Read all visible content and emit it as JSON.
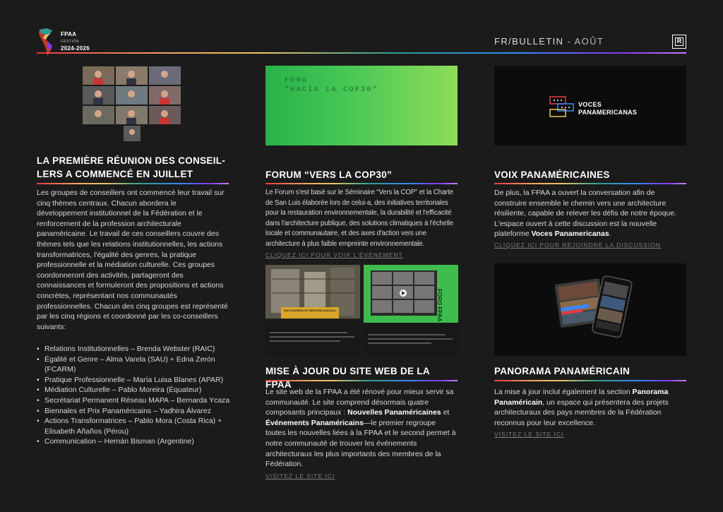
{
  "header": {
    "logo_title": "FPAA",
    "logo_sub": "GESTIÓN",
    "logo_years": "2024-2026",
    "bulletin": "FR/BULLETIN",
    "month": " - AOÛT",
    "r_icon_letter": "R"
  },
  "col1": {
    "title_line1": "LA PREMIÈRE RÉUNION DES CONSEIL-",
    "title_line2": "LERS A COMMENCÉ EN JUILLET",
    "paragraph": "Les groupes de conseillers ont commencé leur travail sur cinq thèmes centraux. Chacun abordera le développement institutionnel de la Fédération et le renforcement de la profession architecturale panaméricaine. Le travail de ces conseillers couvre des thèmes tels que les relations institutionnelles, les actions transformatrices, l'égalité des genres, la pratique professionnelle et la médiation culturelle. Ces groupes coordonneront des activités, partageront des connaissances et formuleront des propositions et actions concrètes, représentant nos communautés professionnelles. Chacun des cinq groupes est représenté par les cinq régions et coordonné par les co-conseillers suivants:",
    "list": [
      "Relations Institutionnelles – Brenda Webster (RAIC)",
      "Égalité et Genre – Alma Varela (SAU) + Edna Zerón (FCARM)",
      "Pratique Professionnelle – María Luisa Blanes (APAR)",
      "Médiation Culturelle – Pablo Moreira (Équateur)",
      "Secrétariat Permanent Réseau MAPA – Bernarda Ycaza",
      "Biennales et Prix Panaméricains – Yadhira Álvarez",
      "Actions Transformatrices – Pablo Mora (Costa Rica) + Elisabeth Añaños (Pérou)",
      "Communication – Hernán Bisman (Argentine)"
    ]
  },
  "col2": {
    "banner_line1": "FORO",
    "banner_line2": "\"HACIA LA COP30\"",
    "title": "FORUM “VERS LA COP30”",
    "paragraph": "Le Forum s'est basé sur le Séminaire “Vers la COP” et la Charte de San Luis élaborée lors de celui-a, des initiatives territoriales pour la restauration environnementale, la durabilité et l'efficacité dans l'architecture publique, des solutions climatiques à l'échelle locale et communautaire, et des axes d'action vers une architecture à plus faible empreinte environnementale.",
    "link": "CLIQUEZ ICI POUR VOIR L'ÉVÉNEMENT",
    "title2": "MISE À JOUR DU SITE WEB DE LA FPAA",
    "p2_a": "Le site web de la FPAA a été rénové pour mieux servir sa communauté. Le site comprend désormais quatre composants principaux : ",
    "p2_b1": "Nouvelles Panaméricaines",
    "p2_c": " et ",
    "p2_b2": "Événements Panaméricains",
    "p2_d": "—le premier regroupe toutes les nouvelles liées à la FPAA et le second permet à notre communauté de trouver les événements architecturaux les plus importants des membres de la Fédération.",
    "link2": "VISITEZ LE SITE ICI",
    "shot1_caption": "SAU CONVERSA DE OBRA REALIZADA (EL)",
    "shot2_caption": "FORO FPAA"
  },
  "col3": {
    "voces_line1": "VOCES",
    "voces_line2": "PANAMERICANAS",
    "title": "VOIX PANAMÉRICAINES",
    "p_a": "De plus, la FPAA a ouvert la conversation afin de construire ensemble le chemin vers une architecture résiliente, capable de relever les défis de notre époque. L'espace ouvert à cette discussion est la nouvelle plateforme ",
    "p_b": "Voces Panamericanas",
    "p_c": ".",
    "link": "CLIQUEZ ICI POUR REJOINDRE LA DISCUSSION",
    "title2": "PANORAMA PANAMÉRICAIN",
    "p2_a": "La mise à jour inclut également la section ",
    "p2_b": "Panorama Panaméricain",
    "p2_c": ", un espace qui présentera des projets architecturaux des pays membres de la Fédération reconnus pour leur excellence.",
    "link2": "VISITEZ LE SITE ICI"
  },
  "colors": {
    "background": "#1b1b1b",
    "cop_green": "#3cc85a",
    "text": "#d8d8d8",
    "link": "#7d7d7d"
  }
}
